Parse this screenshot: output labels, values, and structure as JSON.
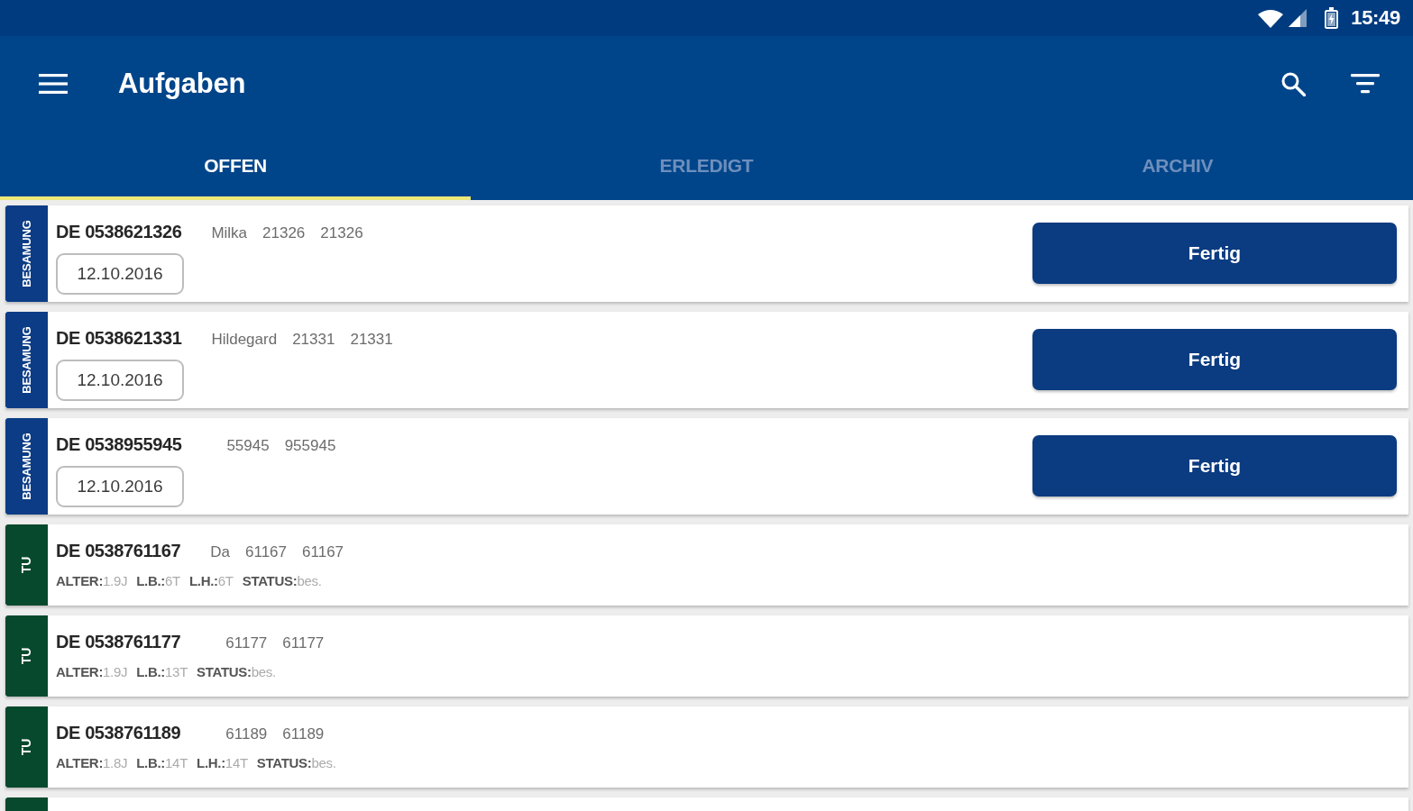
{
  "status_bar": {
    "time": "15:49"
  },
  "app_bar": {
    "title": "Aufgaben"
  },
  "tabs": [
    {
      "label": "OFFEN",
      "selected": true
    },
    {
      "label": "ERLEDIGT",
      "selected": false
    },
    {
      "label": "ARCHIV",
      "selected": false
    }
  ],
  "tasks": [
    {
      "kind": "besamung",
      "badge": "BESAMUNG",
      "id": "DE 0538621326",
      "name": "Milka",
      "numbers": [
        "21326",
        "21326"
      ],
      "date": "12.10.2016",
      "action": "Fertig"
    },
    {
      "kind": "besamung",
      "badge": "BESAMUNG",
      "id": "DE 0538621331",
      "name": "Hildegard",
      "numbers": [
        "21331",
        "21331"
      ],
      "date": "12.10.2016",
      "action": "Fertig"
    },
    {
      "kind": "besamung",
      "badge": "BESAMUNG",
      "id": "DE 0538955945",
      "numbers": [
        "55945",
        "955945"
      ],
      "date": "12.10.2016",
      "action": "Fertig"
    },
    {
      "kind": "tu",
      "badge": "TU",
      "id": "DE 0538761167",
      "name": "Da",
      "numbers": [
        "61167",
        "61167"
      ],
      "details": [
        "**ALTER:**1.9J",
        "**L.B.:**6T",
        "**L.H.:**6T",
        "**STATUS:**bes."
      ]
    },
    {
      "kind": "tu",
      "badge": "TU",
      "id": "DE 0538761177",
      "numbers": [
        "61177",
        "61177"
      ],
      "details": [
        "**ALTER:**1.9J",
        "**L.B.:**13T",
        "**STATUS:**bes."
      ]
    },
    {
      "kind": "tu",
      "badge": "TU",
      "id": "DE 0538761189",
      "numbers": [
        "61189",
        "61189"
      ],
      "details": [
        "**ALTER:**1.8J",
        "**L.B.:**14T",
        "**L.H.:**14T",
        "**STATUS:**bes."
      ]
    },
    {
      "kind": "tu"
    }
  ]
}
